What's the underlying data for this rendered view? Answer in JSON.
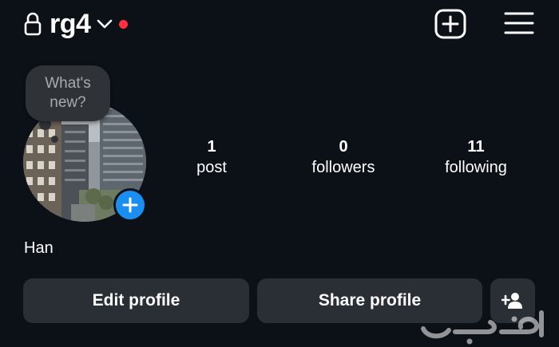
{
  "header": {
    "username": "rg4",
    "icons": {
      "lock": "lock-icon",
      "chevron": "chevron-down-icon",
      "new_post": "plus-square-icon",
      "menu": "hamburger-menu-icon"
    },
    "live_dot_color": "#ff3040"
  },
  "note": {
    "line1": "What's",
    "line2": "new?"
  },
  "stats": [
    {
      "value": "1",
      "label": "post"
    },
    {
      "value": "0",
      "label": "followers"
    },
    {
      "value": "11",
      "label": "following"
    }
  ],
  "profile": {
    "display_name": "Han"
  },
  "actions": {
    "edit_profile": "Edit profile",
    "share_profile": "Share profile",
    "add_person_icon": "person-add-icon"
  },
  "colors": {
    "background": "#0c1118",
    "button_bg": "#2a2f36",
    "accent_blue": "#1b8ef2"
  }
}
